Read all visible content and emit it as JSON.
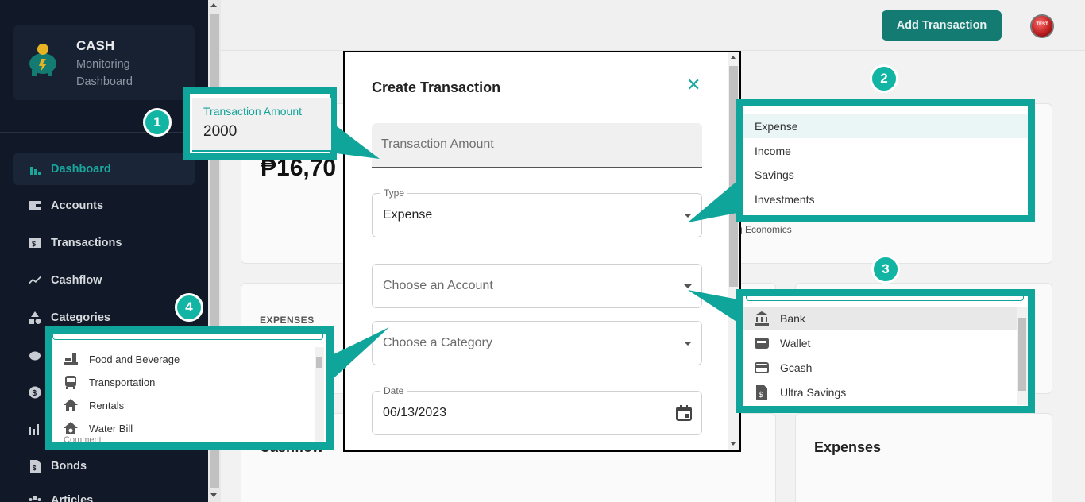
{
  "sidebar": {
    "brand_title": "CASH",
    "brand_line1": "Monitoring",
    "brand_line2": "Dashboard",
    "items": [
      {
        "label": "Dashboard",
        "icon": "bar-chart-icon"
      },
      {
        "label": "Accounts",
        "icon": "wallet-icon"
      },
      {
        "label": "Transactions",
        "icon": "money-icon"
      },
      {
        "label": "Cashflow",
        "icon": "trend-icon"
      },
      {
        "label": "Categories",
        "icon": "shapes-icon"
      },
      {
        "label": "Bonds",
        "icon": "document-icon"
      },
      {
        "label": "Articles",
        "icon": "users-icon"
      }
    ]
  },
  "header": {
    "add_button": "Add Transaction",
    "avatar_text": "TEST"
  },
  "background": {
    "amount": "₱16,70",
    "expenses_label": "EXPENSES",
    "econ_link": "g Economics",
    "cashflow_title": "Cashflow",
    "expenses_title": "Expenses"
  },
  "modal": {
    "title": "Create Transaction",
    "amount_placeholder": "Transaction Amount",
    "type_label": "Type",
    "type_value": "Expense",
    "account_placeholder": "Choose an Account",
    "category_placeholder": "Choose a Category",
    "date_label": "Date",
    "date_value": "06/13/2023"
  },
  "callout1": {
    "number": "1",
    "label": "Transaction Amount",
    "value": "2000"
  },
  "callout2": {
    "number": "2",
    "options": [
      "Expense",
      "Income",
      "Savings",
      "Investments"
    ]
  },
  "callout3": {
    "number": "3",
    "options": [
      {
        "label": "Bank",
        "icon": "bank-icon"
      },
      {
        "label": "Wallet",
        "icon": "wallet-icon"
      },
      {
        "label": "Gcash",
        "icon": "card-icon"
      },
      {
        "label": "Ultra Savings",
        "icon": "dollar-doc-icon"
      }
    ]
  },
  "callout4": {
    "number": "4",
    "options": [
      {
        "label": "Food and Beverage",
        "icon": "food-icon"
      },
      {
        "label": "Transportation",
        "icon": "bus-icon"
      },
      {
        "label": "Rentals",
        "icon": "home-icon"
      },
      {
        "label": "Water Bill",
        "icon": "house-drop-icon"
      }
    ],
    "peek_text": "Comment"
  },
  "colors": {
    "accent": "#0fa59b",
    "sidebar_bg": "#111827",
    "button": "#147b72"
  }
}
